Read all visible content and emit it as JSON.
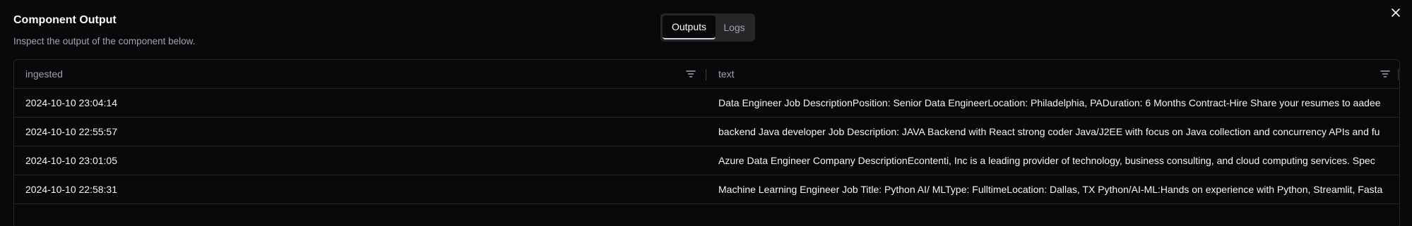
{
  "dialog": {
    "title": "Component Output",
    "subtitle": "Inspect the output of the component below.",
    "close_icon": "close-icon"
  },
  "tabs": [
    {
      "label": "Outputs",
      "active": true
    },
    {
      "label": "Logs",
      "active": false
    }
  ],
  "table": {
    "columns": [
      {
        "label": "ingested",
        "icon": "filter-icon"
      },
      {
        "label": "text",
        "icon": "filter-icon"
      }
    ],
    "rows": [
      {
        "ingested": "2024-10-10 23:04:14",
        "text": "Data Engineer Job DescriptionPosition: Senior Data EngineerLocation: Philadelphia, PADuration: 6 Months Contract-Hire Share your resumes to aadee"
      },
      {
        "ingested": "2024-10-10 22:55:57",
        "text": "backend Java developer Job Description: JAVA Backend with React strong coder Java/J2EE with focus on Java collection and concurrency APIs and fu"
      },
      {
        "ingested": "2024-10-10 23:01:05",
        "text": "Azure Data Engineer Company DescriptionEcontenti, Inc is a leading provider of technology, business consulting, and cloud computing services. Spec"
      },
      {
        "ingested": "2024-10-10 22:58:31",
        "text": "Machine Learning Engineer Job Title: Python AI/ MLType: FulltimeLocation: Dallas, TX Python/AI-ML:Hands on experience with Python, Streamlit, Fasta"
      }
    ]
  },
  "colors": {
    "background": "#09090b",
    "border": "#27272a",
    "muted_text": "#a1a1aa",
    "text": "#fafafa",
    "tab_bg": "#27272a"
  }
}
